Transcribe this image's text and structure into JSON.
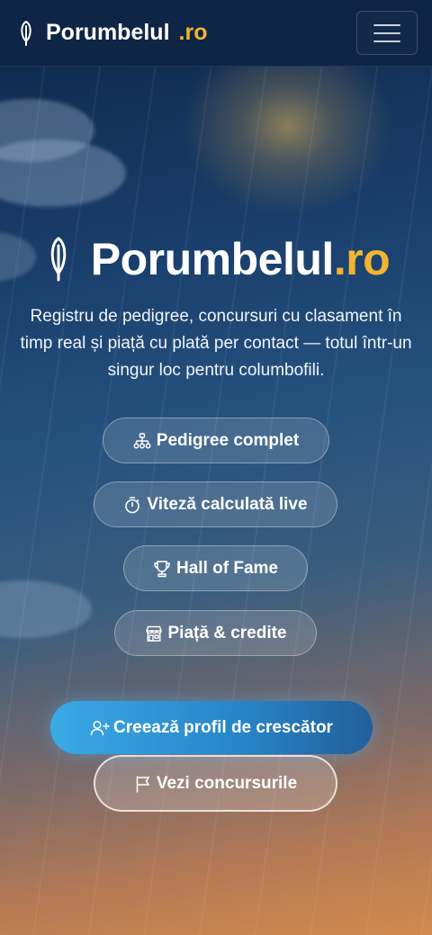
{
  "navbar": {
    "brand_name": "Porumbelul",
    "brand_tld": ".ro",
    "menu_icon": "hamburger-icon"
  },
  "hero": {
    "title_name": "Porumbelul",
    "title_tld": ".ro",
    "subtitle": "Registru de pedigree, concursuri cu clasament în timp real și piață cu plată per contact — totul într-un singur loc pentru columbofili."
  },
  "features": [
    {
      "label": "Pedigree complet",
      "icon": "sitemap-icon"
    },
    {
      "label": "Viteză calculată live",
      "icon": "stopwatch-icon"
    },
    {
      "label": "Hall of Fame",
      "icon": "trophy-icon"
    },
    {
      "label": "Piață & credite",
      "icon": "shop-icon"
    }
  ],
  "actions": {
    "primary_label": "Creează profil de crescător",
    "secondary_label": "Vezi concursurile"
  },
  "colors": {
    "navbar_bg": "#0f2545",
    "accent": "#f2b431",
    "primary_button": "#2784c7"
  }
}
